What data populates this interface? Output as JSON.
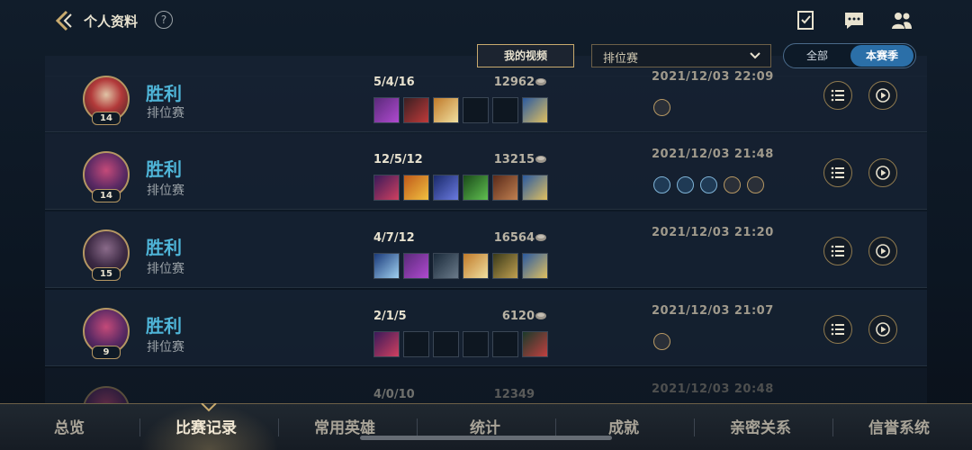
{
  "header": {
    "title": "个人资料",
    "help": "?"
  },
  "filters": {
    "video_button": "我的视频",
    "mode_select": "排位赛",
    "season_tabs": [
      "全部",
      "本赛季"
    ],
    "season_selected": "本赛季"
  },
  "matches": [
    {
      "result": "胜利",
      "mode": "排位赛",
      "level": "14",
      "kda": "5/4/16",
      "gold": "12962",
      "date": "2021/12/03 22:09",
      "avatar": "red",
      "runes": 1
    },
    {
      "result": "胜利",
      "mode": "排位赛",
      "level": "14",
      "kda": "12/5/12",
      "gold": "13215",
      "date": "2021/12/03 21:48",
      "avatar": "purple",
      "runes": 5
    },
    {
      "result": "胜利",
      "mode": "排位赛",
      "level": "15",
      "kda": "4/7/12",
      "gold": "16564",
      "date": "2021/12/03 21:20",
      "avatar": "dark",
      "runes": 0
    },
    {
      "result": "胜利",
      "mode": "排位赛",
      "level": "9",
      "kda": "2/1/5",
      "gold": "6120",
      "date": "2021/12/03 21:07",
      "avatar": "purple",
      "runes": 1
    },
    {
      "result": "",
      "mode": "",
      "level": "",
      "kda": "4/0/10",
      "gold": "12349",
      "date": "2021/12/03 20:48",
      "avatar": "purple",
      "runes": 0
    }
  ],
  "bottom_nav": [
    "总览",
    "比赛记录",
    "常用英雄",
    "统计",
    "成就",
    "亲密关系",
    "信誉系统"
  ],
  "bottom_nav_active": "比赛记录",
  "colors": {
    "accent": "#c8aa6e",
    "victory": "#4fb5d8",
    "active_tab": "#2b6fa8"
  }
}
